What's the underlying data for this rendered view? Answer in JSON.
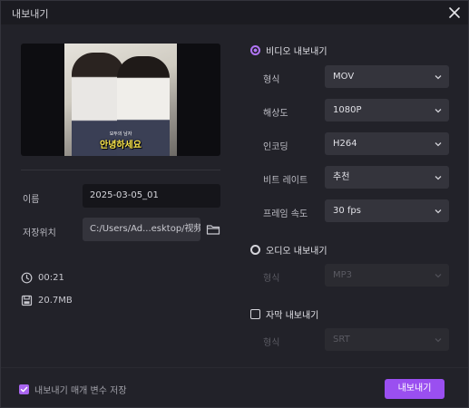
{
  "window": {
    "title": "내보내기"
  },
  "preview": {
    "caption_small": "모두의 남자",
    "caption_big": "안녕하세요"
  },
  "left": {
    "name_label": "이름",
    "name_value": "2025-03-05_01",
    "path_label": "저장위치",
    "path_value": "C:/Users/Ad...esktop/视频素材",
    "duration": "00:21",
    "size": "20.7MB"
  },
  "video": {
    "section_label": "비디오 내보내기",
    "rows": [
      {
        "label": "형식",
        "value": "MOV"
      },
      {
        "label": "해상도",
        "value": "1080P"
      },
      {
        "label": "인코딩",
        "value": "H264"
      },
      {
        "label": "비트 레이트",
        "value": "추천"
      },
      {
        "label": "프레임 속도",
        "value": "30  fps"
      }
    ]
  },
  "audio": {
    "section_label": "오디오 내보내기",
    "format_label": "형식",
    "format_value": "MP3"
  },
  "subtitle": {
    "section_label": "자막 내보내기",
    "format_label": "형식",
    "format_value": "SRT"
  },
  "footer": {
    "save_params_label": "내보내기 매개 변수 저장",
    "export_label": "내보내기"
  },
  "colors": {
    "accent": "#9a4ff0",
    "background": "#222229"
  }
}
